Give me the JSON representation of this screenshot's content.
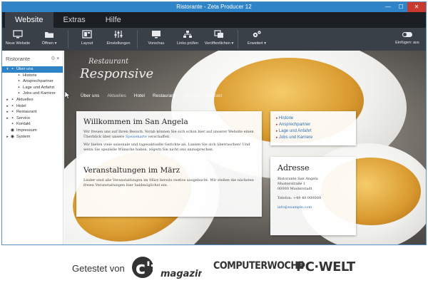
{
  "window": {
    "title": "Ristorante - Zeta Producer 12"
  },
  "titlebar_controls": {
    "minimize": "—",
    "maximize": "☐",
    "close": "✕"
  },
  "tabs": [
    {
      "label": "Website",
      "active": true
    },
    {
      "label": "Extras",
      "active": false
    },
    {
      "label": "Hilfe",
      "active": false
    }
  ],
  "ribbon": {
    "buttons": [
      {
        "label": "Neue Website",
        "icon": "monitor-icon"
      },
      {
        "label": "Öffnen ▾",
        "icon": "folder-icon"
      },
      {
        "label": "Layout",
        "icon": "layout-icon"
      },
      {
        "label": "Einstellungen",
        "icon": "sliders-icon"
      },
      {
        "label": "Vorschau",
        "icon": "preview-icon"
      },
      {
        "label": "Links prüfen",
        "icon": "sitemap-icon"
      },
      {
        "label": "Veröffentlichen ▾",
        "icon": "publish-icon"
      },
      {
        "label": "Erweitert ▾",
        "icon": "gears-icon"
      }
    ],
    "insert_label": "Einfügen: aus"
  },
  "sidebar": {
    "title": "Ristorante",
    "items": [
      {
        "label": "Über uns",
        "level": 0,
        "expander": "▾",
        "icon": "page-icon",
        "selected": true
      },
      {
        "label": "Historie",
        "level": 1,
        "expander": "",
        "icon": "page-icon",
        "selected": false
      },
      {
        "label": "Ansprechpartner",
        "level": 1,
        "expander": "",
        "icon": "page-icon",
        "selected": false
      },
      {
        "label": "Lage und Anfahrt",
        "level": 1,
        "expander": "",
        "icon": "page-icon",
        "selected": false
      },
      {
        "label": "Jobs und Karriere",
        "level": 1,
        "expander": "",
        "icon": "page-icon",
        "selected": false
      },
      {
        "label": "Aktuelles",
        "level": 0,
        "expander": "▸",
        "icon": "page-icon",
        "selected": false
      },
      {
        "label": "Hotel",
        "level": 0,
        "expander": "▸",
        "icon": "page-icon",
        "selected": false
      },
      {
        "label": "Restaurant",
        "level": 0,
        "expander": "▸",
        "icon": "page-icon",
        "selected": false
      },
      {
        "label": "Service",
        "level": 0,
        "expander": "▸",
        "icon": "page-icon",
        "selected": false
      },
      {
        "label": "Kontakt",
        "level": 0,
        "expander": "",
        "icon": "page-icon",
        "selected": false
      },
      {
        "label": "Impressum",
        "level": 0,
        "expander": "",
        "icon": "eye-icon",
        "selected": false
      },
      {
        "label": "System",
        "level": 0,
        "expander": "▸",
        "icon": "eye-icon",
        "selected": false
      }
    ]
  },
  "site": {
    "logo_line1": "Restaurant",
    "logo_line2": "Responsive",
    "nav": [
      "Über uns",
      "Aktuelles",
      "Hotel",
      "Restaurant",
      "Service",
      "Kontakt"
    ],
    "welcome_title": "Willkommen im San Angela",
    "welcome_p1_before": "Wir freuen uns auf Ihren Besuch. Vorab können Sie sich schon hier auf unserer Website einen Überblick über unsere ",
    "welcome_p1_link": "Speisekarte",
    "welcome_p1_after": " verschaffen.",
    "welcome_p2": "Wir bieten viele saisonale und tagesaktuelle Gerichte an. Lassen Sie sich überraschen! Und wenn Sie spezielle Wünsche haben, zögern Sie nicht uns anzusprechen.",
    "events_title": "Veranstaltungen im März",
    "events_p": "Leider sind alle Veranstaltungen im März bereits restlos ausgebucht. Wir stellen die nächsten freien Veranstaltungen hier baldmöglichst ein.",
    "links": [
      "Historie",
      "Ansprechpartner",
      "Lage und Anfahrt",
      "Jobs und Karriere"
    ],
    "address_title": "Adresse",
    "address_lines": [
      "Ristorante San Angela",
      "Musterstraße 1",
      "00000 Musterstadt"
    ],
    "phone": "Telefon: +49 40 000000",
    "email": "info@example.com"
  },
  "banner": {
    "tested": "Getestet von",
    "ct_big": "c't",
    "ct_small": "magazin",
    "cw": "COMPUTERWOCHE",
    "pcw": "PC·WELT"
  }
}
